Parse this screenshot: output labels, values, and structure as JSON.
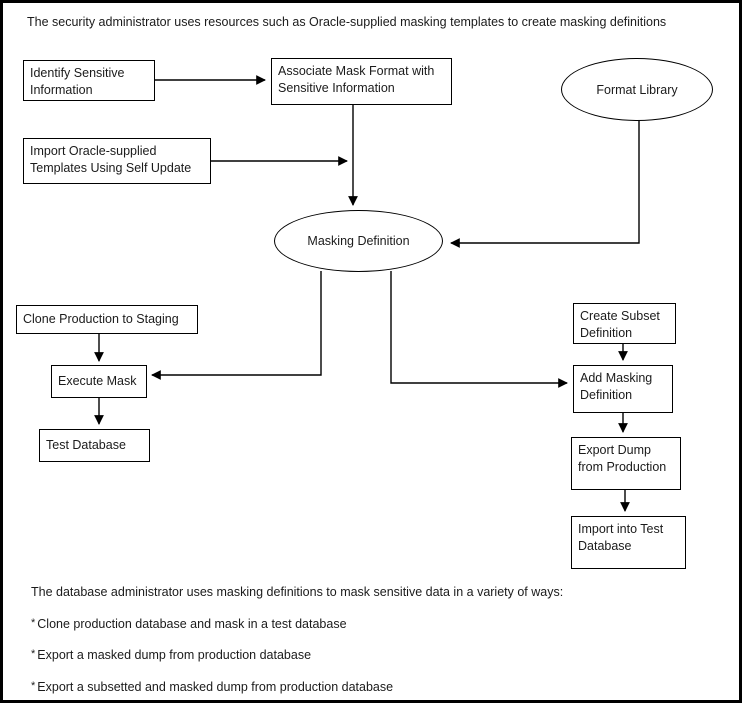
{
  "diagram": {
    "header_text": "The security administrator uses resources such as Oracle-supplied masking templates to create masking definitions",
    "footer": {
      "intro": "The database administrator uses masking definitions to mask sensitive data in a variety of ways:",
      "bullet_marker": "*",
      "bullets": [
        "Clone production database and mask in a test database",
        "Export a masked dump from production database",
        "Export a subsetted and masked dump from production database"
      ]
    },
    "colors": {
      "border": "#000000",
      "text": "#1b1b1b",
      "background": "#ffffff",
      "line": "#000000"
    },
    "nodes": {
      "identify_sensitive_information": "Identify Sensitive\nInformation",
      "associate_mask_format": "Associate Mask Format with\nSensitive Information",
      "format_library": "Format Library",
      "import_oracle_templates": "Import Oracle-supplied\nTemplates Using Self Update",
      "masking_definition": "Masking Definition",
      "clone_production_to_staging": "Clone Production to Staging",
      "execute_mask": "Execute Mask",
      "test_database": "Test Database",
      "create_subset_definition": "Create Subset\nDefinition",
      "add_masking_definition": "Add Masking\nDefinition",
      "export_dump_from_production": "Export Dump\nfrom Production",
      "import_into_test_database": "Import into Test\nDatabase"
    },
    "edges": [
      {
        "from": "identify_sensitive_information",
        "to": "associate_mask_format"
      },
      {
        "from": "associate_mask_format",
        "to": "masking_definition"
      },
      {
        "from": "import_oracle_templates",
        "to": "masking_definition"
      },
      {
        "from": "format_library",
        "to": "masking_definition"
      },
      {
        "from": "masking_definition",
        "to": "execute_mask"
      },
      {
        "from": "masking_definition",
        "to": "add_masking_definition"
      },
      {
        "from": "clone_production_to_staging",
        "to": "execute_mask"
      },
      {
        "from": "execute_mask",
        "to": "test_database"
      },
      {
        "from": "create_subset_definition",
        "to": "add_masking_definition"
      },
      {
        "from": "add_masking_definition",
        "to": "export_dump_from_production"
      },
      {
        "from": "export_dump_from_production",
        "to": "import_into_test_database"
      }
    ]
  }
}
